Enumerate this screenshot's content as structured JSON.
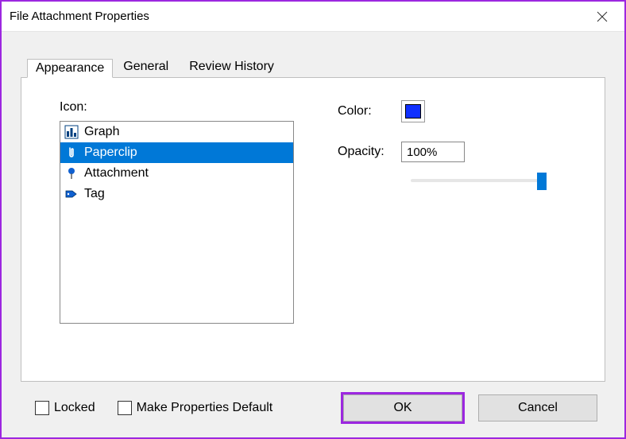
{
  "window": {
    "title": "File Attachment Properties"
  },
  "tabs": [
    {
      "label": "Appearance",
      "active": true
    },
    {
      "label": "General",
      "active": false
    },
    {
      "label": "Review History",
      "active": false
    }
  ],
  "appearance": {
    "iconLabel": "Icon:",
    "icons": [
      {
        "name": "Graph",
        "selected": false,
        "icon": "graph"
      },
      {
        "name": "Paperclip",
        "selected": true,
        "icon": "paperclip"
      },
      {
        "name": "Attachment",
        "selected": false,
        "icon": "pushpin"
      },
      {
        "name": "Tag",
        "selected": false,
        "icon": "tag"
      }
    ],
    "colorLabel": "Color:",
    "colorValue": "#1030ff",
    "opacityLabel": "Opacity:",
    "opacityValue": "100%",
    "sliderPercent": 100
  },
  "footer": {
    "lockedLabel": "Locked",
    "lockedChecked": false,
    "defaultLabel": "Make Properties Default",
    "defaultChecked": false,
    "okLabel": "OK",
    "cancelLabel": "Cancel"
  }
}
